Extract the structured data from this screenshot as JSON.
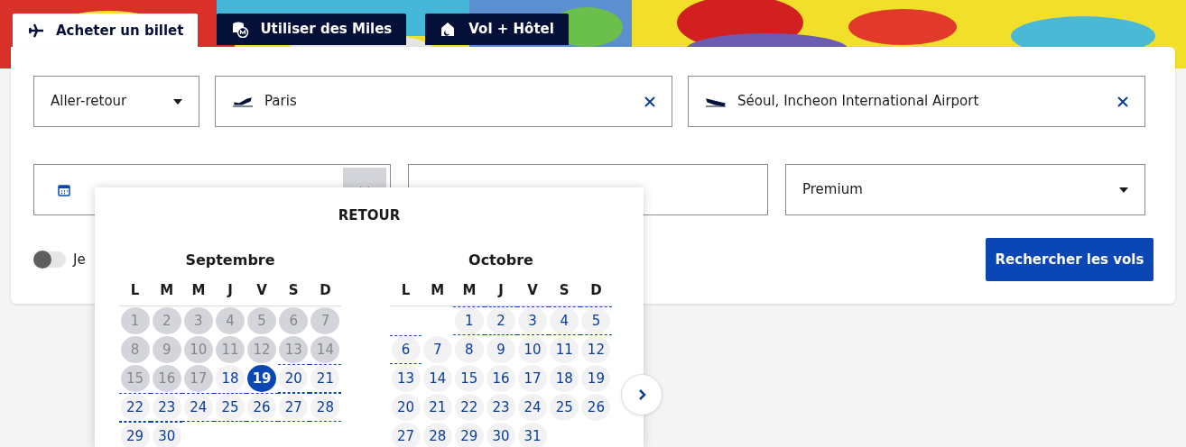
{
  "tabs": [
    {
      "label": "Acheter un billet",
      "selected": true
    },
    {
      "label": "Utiliser des Miles",
      "selected": false
    },
    {
      "label": "Vol + Hôtel",
      "selected": false
    }
  ],
  "trip_type": {
    "value": "Aller-retour"
  },
  "origin": {
    "value": "Paris"
  },
  "destination": {
    "value": "Séoul, Incheon International Airport"
  },
  "dates": {
    "expanded": true
  },
  "cabin": {
    "value": "Premium"
  },
  "toggle": {
    "label": "Je",
    "on": false
  },
  "search_button": {
    "label": "Rechercher les vols"
  },
  "calendar": {
    "title": "RETOUR",
    "months": [
      {
        "name": "Septembre",
        "weekdays": [
          "L",
          "M",
          "M",
          "J",
          "V",
          "S",
          "D"
        ],
        "weeks": [
          [
            {
              "day": "1",
              "disabled": true,
              "selected": false,
              "in_range": false
            },
            {
              "day": "2",
              "disabled": true,
              "selected": false,
              "in_range": false
            },
            {
              "day": "3",
              "disabled": true,
              "selected": false,
              "in_range": false
            },
            {
              "day": "4",
              "disabled": true,
              "selected": false,
              "in_range": false
            },
            {
              "day": "5",
              "disabled": true,
              "selected": false,
              "in_range": false
            },
            {
              "day": "6",
              "disabled": true,
              "selected": false,
              "in_range": false
            },
            {
              "day": "7",
              "disabled": true,
              "selected": false,
              "in_range": false
            }
          ],
          [
            {
              "day": "8",
              "disabled": true,
              "selected": false,
              "in_range": false
            },
            {
              "day": "9",
              "disabled": true,
              "selected": false,
              "in_range": false
            },
            {
              "day": "10",
              "disabled": true,
              "selected": false,
              "in_range": false
            },
            {
              "day": "11",
              "disabled": true,
              "selected": false,
              "in_range": false
            },
            {
              "day": "12",
              "disabled": true,
              "selected": false,
              "in_range": false
            },
            {
              "day": "13",
              "disabled": true,
              "selected": false,
              "in_range": false
            },
            {
              "day": "14",
              "disabled": true,
              "selected": false,
              "in_range": false
            }
          ],
          [
            {
              "day": "15",
              "disabled": true,
              "selected": false,
              "in_range": false
            },
            {
              "day": "16",
              "disabled": true,
              "selected": false,
              "in_range": false
            },
            {
              "day": "17",
              "disabled": true,
              "selected": false,
              "in_range": false
            },
            {
              "day": "18",
              "disabled": false,
              "selected": false,
              "in_range": false
            },
            {
              "day": "19",
              "disabled": false,
              "selected": true,
              "in_range": false
            },
            {
              "day": "20",
              "disabled": false,
              "selected": false,
              "in_range": true
            },
            {
              "day": "21",
              "disabled": false,
              "selected": false,
              "in_range": true
            }
          ],
          [
            {
              "day": "22",
              "disabled": false,
              "selected": false,
              "in_range": true
            },
            {
              "day": "23",
              "disabled": false,
              "selected": false,
              "in_range": true
            },
            {
              "day": "24",
              "disabled": false,
              "selected": false,
              "in_range": true
            },
            {
              "day": "25",
              "disabled": false,
              "selected": false,
              "in_range": true
            },
            {
              "day": "26",
              "disabled": false,
              "selected": false,
              "in_range": true
            },
            {
              "day": "27",
              "disabled": false,
              "selected": false,
              "in_range": true
            },
            {
              "day": "28",
              "disabled": false,
              "selected": false,
              "in_range": true
            }
          ],
          [
            {
              "day": "29",
              "disabled": false,
              "selected": false,
              "in_range": true
            },
            {
              "day": "30",
              "disabled": false,
              "selected": false,
              "in_range": true
            }
          ]
        ]
      },
      {
        "name": "Octobre",
        "weekdays": [
          "L",
          "M",
          "M",
          "J",
          "V",
          "S",
          "D"
        ],
        "weeks": [
          [
            {
              "day": "1",
              "disabled": false,
              "selected": false,
              "in_range": true
            },
            {
              "day": "2",
              "disabled": false,
              "selected": false,
              "in_range": true
            },
            {
              "day": "3",
              "disabled": false,
              "selected": false,
              "in_range": true
            },
            {
              "day": "4",
              "disabled": false,
              "selected": false,
              "in_range": true
            },
            {
              "day": "5",
              "disabled": false,
              "selected": false,
              "in_range": true
            }
          ],
          [
            {
              "day": "6",
              "disabled": false,
              "selected": false,
              "in_range": true
            },
            {
              "day": "7",
              "disabled": false,
              "selected": false,
              "in_range": false
            },
            {
              "day": "8",
              "disabled": false,
              "selected": false,
              "in_range": false
            },
            {
              "day": "9",
              "disabled": false,
              "selected": false,
              "in_range": false
            },
            {
              "day": "10",
              "disabled": false,
              "selected": false,
              "in_range": false
            },
            {
              "day": "11",
              "disabled": false,
              "selected": false,
              "in_range": false
            },
            {
              "day": "12",
              "disabled": false,
              "selected": false,
              "in_range": false
            }
          ],
          [
            {
              "day": "13",
              "disabled": false,
              "selected": false,
              "in_range": false
            },
            {
              "day": "14",
              "disabled": false,
              "selected": false,
              "in_range": false
            },
            {
              "day": "15",
              "disabled": false,
              "selected": false,
              "in_range": false
            },
            {
              "day": "16",
              "disabled": false,
              "selected": false,
              "in_range": false
            },
            {
              "day": "17",
              "disabled": false,
              "selected": false,
              "in_range": false
            },
            {
              "day": "18",
              "disabled": false,
              "selected": false,
              "in_range": false
            },
            {
              "day": "19",
              "disabled": false,
              "selected": false,
              "in_range": false
            }
          ],
          [
            {
              "day": "20",
              "disabled": false,
              "selected": false,
              "in_range": false
            },
            {
              "day": "21",
              "disabled": false,
              "selected": false,
              "in_range": false
            },
            {
              "day": "22",
              "disabled": false,
              "selected": false,
              "in_range": false
            },
            {
              "day": "23",
              "disabled": false,
              "selected": false,
              "in_range": false
            },
            {
              "day": "24",
              "disabled": false,
              "selected": false,
              "in_range": false
            },
            {
              "day": "25",
              "disabled": false,
              "selected": false,
              "in_range": false
            },
            {
              "day": "26",
              "disabled": false,
              "selected": false,
              "in_range": false
            }
          ],
          [
            {
              "day": "27",
              "disabled": false,
              "selected": false,
              "in_range": false
            },
            {
              "day": "28",
              "disabled": false,
              "selected": false,
              "in_range": false
            },
            {
              "day": "29",
              "disabled": false,
              "selected": false,
              "in_range": false
            },
            {
              "day": "30",
              "disabled": false,
              "selected": false,
              "in_range": false
            },
            {
              "day": "31",
              "disabled": false,
              "selected": false,
              "in_range": false
            }
          ]
        ]
      }
    ]
  }
}
